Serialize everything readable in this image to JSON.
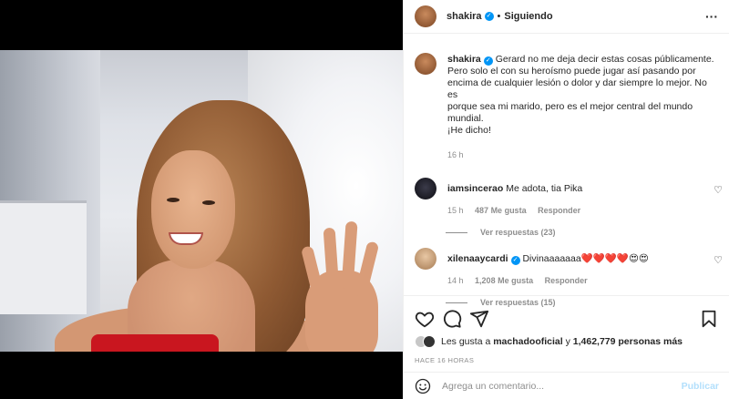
{
  "post": {
    "username": "shakira",
    "follow_status": "Siguiendo",
    "caption_lines": [
      "Gerard no me deja decir estas cosas públicamente.",
      "Pero solo el con su heroísmo puede jugar así pasando por",
      "encima de cualquier lesión o dolor y dar siempre lo mejor. No es",
      "porque sea mi marido, pero es el mejor central del mundo",
      "mundial.",
      "¡He dicho!"
    ],
    "caption_time": "16 h"
  },
  "comments": [
    {
      "username": "iamsincerao",
      "text": "Me adota, tia Pika",
      "time": "15 h",
      "likes": "487 Me gusta",
      "reply": "Responder",
      "view_replies": "Ver respuestas (23)"
    },
    {
      "username": "xilenaaycardi",
      "text": "Divinaaaaaaa❤️❤️❤️❤️😍😍",
      "time": "14 h",
      "likes": "1,208 Me gusta",
      "reply": "Responder",
      "view_replies": "Ver respuestas (15)"
    }
  ],
  "likes_line": {
    "prefix": "Les gusta a",
    "user": "machadooficial",
    "middle": "y",
    "count": "1,462,779 personas más"
  },
  "timestamp": "HACE 16 HORAS",
  "composer": {
    "placeholder": "Agrega un comentario...",
    "publish_label": "Publicar"
  },
  "colors": {
    "accent": "#0095f6",
    "publish_disabled": "#b2dffc",
    "secondary_text": "#8e8e8e"
  },
  "icons": [
    "more-options-icon",
    "heart-icon",
    "comment-icon",
    "share-icon",
    "bookmark-icon",
    "emoji-icon",
    "verified-badge-icon"
  ]
}
